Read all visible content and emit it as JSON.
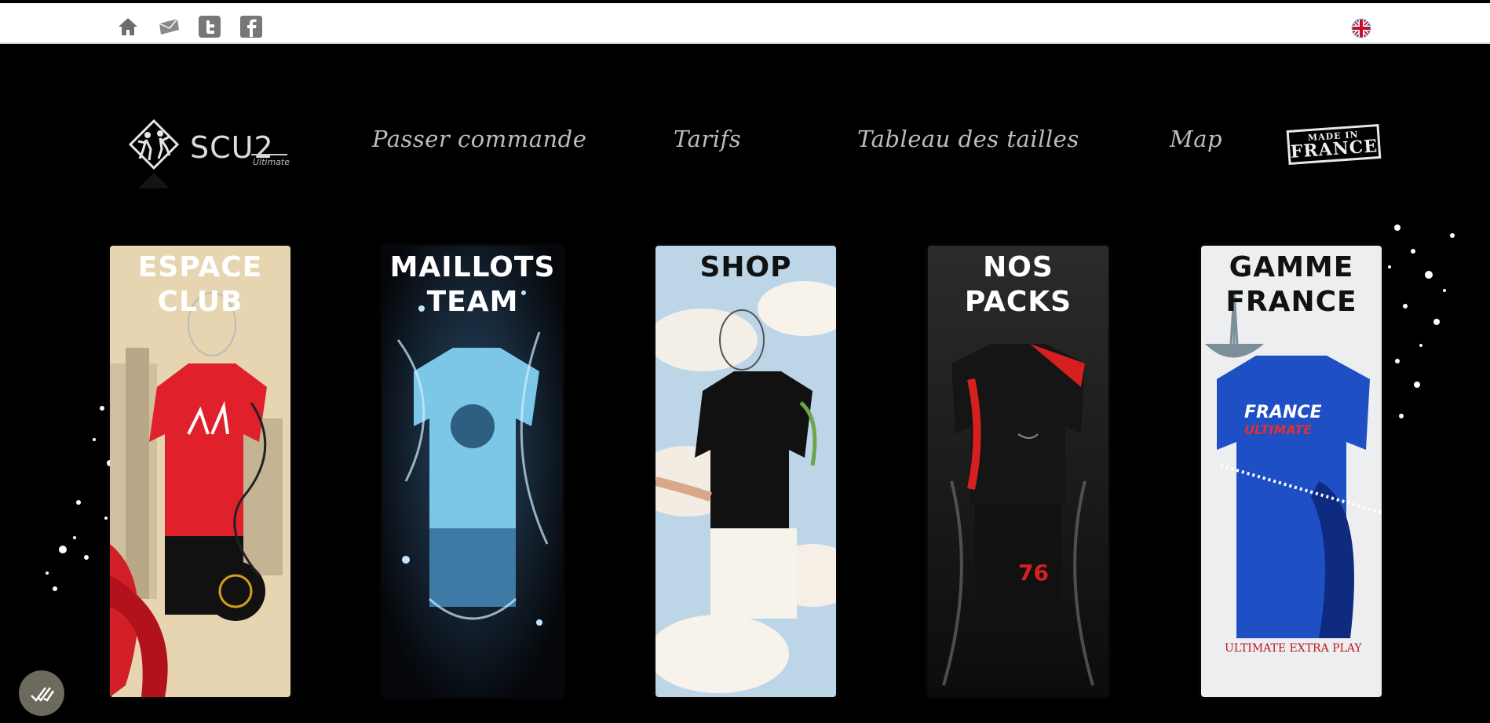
{
  "topbar": {
    "icons": [
      "home-icon",
      "mail-icon",
      "twitter-icon",
      "facebook-icon"
    ],
    "language_flag": "uk-flag-icon"
  },
  "logo": {
    "text": "SCU2",
    "subtitle": "Ultimate"
  },
  "nav": {
    "items": [
      "Passer commande",
      "Tarifs",
      "Tableau des tailles",
      "Map"
    ],
    "badge": {
      "line1": "MADE IN",
      "line2": "FRANCE"
    }
  },
  "panels": [
    {
      "line1": "ESPACE",
      "line2": "CLUB"
    },
    {
      "line1": "MAILLOTS",
      "line2": "TEAM"
    },
    {
      "line1": "SHOP",
      "line2": ""
    },
    {
      "line1": "NOS",
      "line2": "PACKS"
    },
    {
      "line1": "GAMME",
      "line2": "FRANCE"
    }
  ],
  "panel_shirt_texts": {
    "france_front": "FRANCE",
    "france_front_sub": "ULTIMATE",
    "france_words": "ULTIMATE EXTRA PLAY",
    "packs_number": "76"
  },
  "colors": {
    "background": "#000000",
    "topbar": "#ffffff",
    "nav_text": "#bdbdbd",
    "club_shirt": "#e0202a",
    "team_shirt": "#7cc6e8",
    "france_shirt": "#1f4fc4"
  }
}
